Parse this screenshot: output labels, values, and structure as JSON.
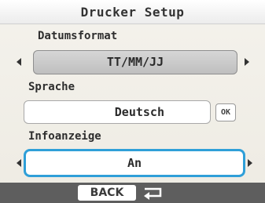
{
  "window": {
    "title": "Drucker Setup"
  },
  "sections": {
    "date_format": {
      "label": "Datumsformat",
      "value": "TT/MM/JJ"
    },
    "language": {
      "label": "Sprache",
      "value": "Deutsch",
      "ok_label": "OK"
    },
    "info_display": {
      "label": "Infoanzeige",
      "value": "An"
    }
  },
  "footer": {
    "back_label": "BACK"
  },
  "icons": {
    "left_arrow": "triangle-left-icon",
    "right_arrow": "triangle-right-icon",
    "return": "return-arrow-icon"
  },
  "colors": {
    "selection_outline": "#2f9fd8",
    "footer_background": "#5e5e5e"
  }
}
